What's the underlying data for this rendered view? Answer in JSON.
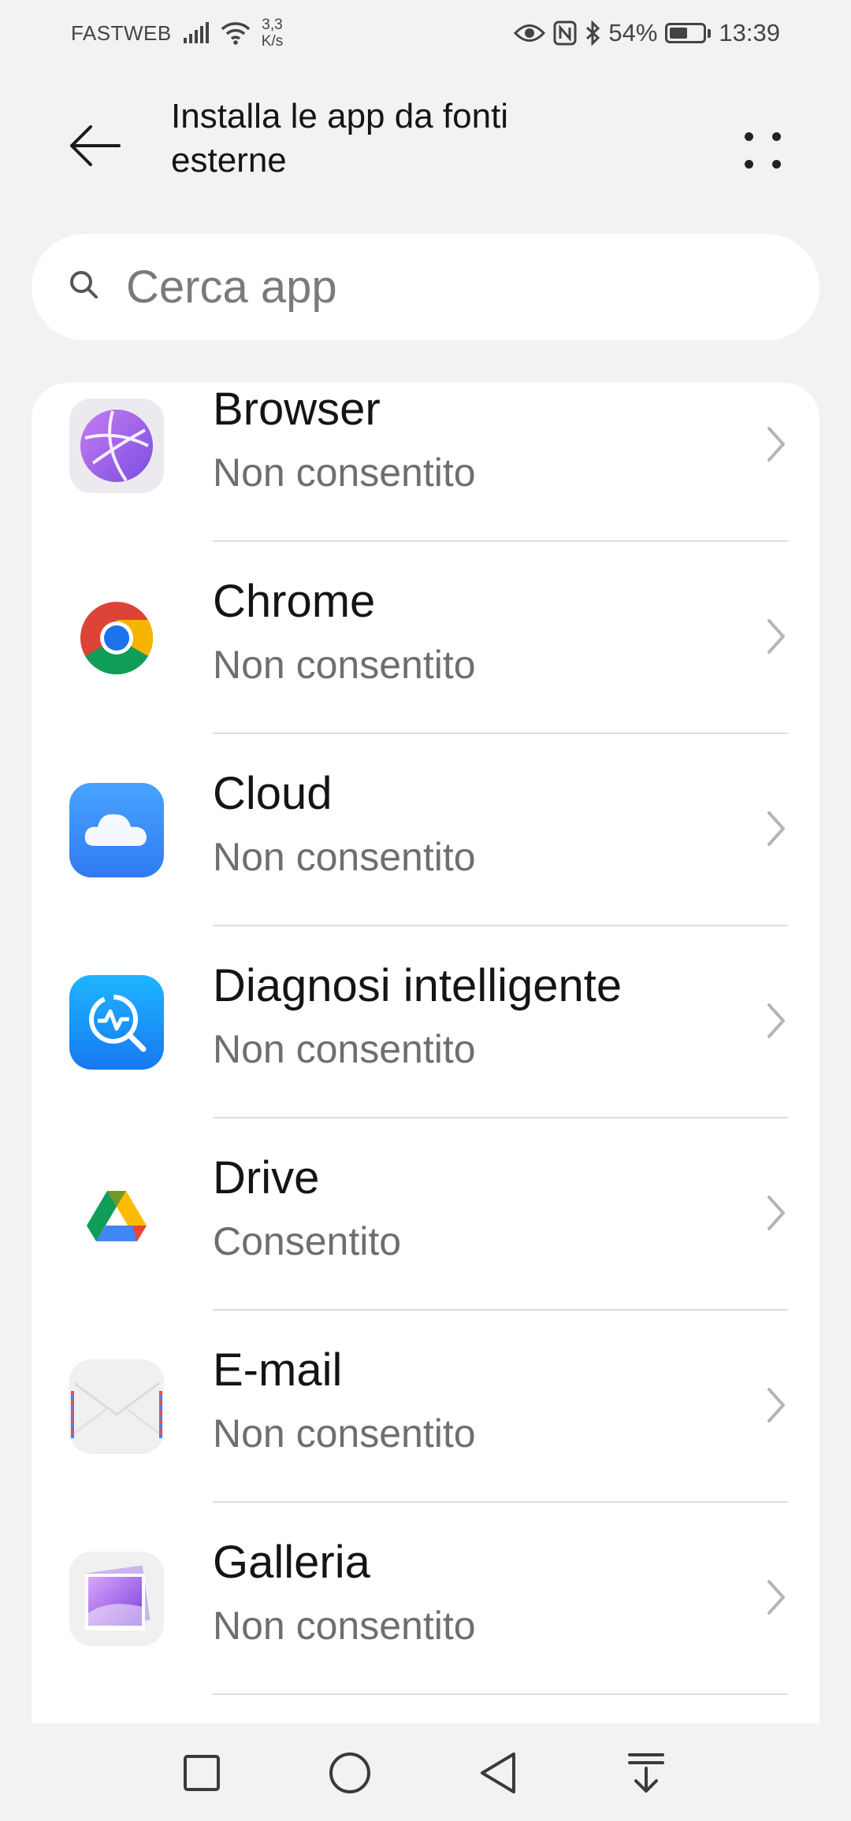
{
  "status_bar": {
    "carrier": "FASTWEB",
    "speed_value": "3,3",
    "speed_unit": "K/s",
    "battery": "54%",
    "battery_level": 0.54,
    "time": "13:39",
    "icons": [
      "signal-icon",
      "wifi-icon",
      "eye-icon",
      "nfc-icon",
      "bluetooth-icon",
      "battery-icon"
    ]
  },
  "header": {
    "title_line1": "Installa le app da fonti",
    "title_line2": "esterne",
    "back_icon": "back-arrow-icon",
    "more_icon": "more-options-icon"
  },
  "search": {
    "placeholder": "Cerca app",
    "value": ""
  },
  "apps": [
    {
      "name": "Browser",
      "status": "Non consentito",
      "icon": "browser-app-icon"
    },
    {
      "name": "Chrome",
      "status": "Non consentito",
      "icon": "chrome-app-icon"
    },
    {
      "name": "Cloud",
      "status": "Non consentito",
      "icon": "cloud-app-icon"
    },
    {
      "name": "Diagnosi intelligente",
      "status": "Non consentito",
      "icon": "diagnosis-app-icon"
    },
    {
      "name": "Drive",
      "status": "Consentito",
      "icon": "drive-app-icon"
    },
    {
      "name": "E-mail",
      "status": "Non consentito",
      "icon": "email-app-icon"
    },
    {
      "name": "Galleria",
      "status": "Non consentito",
      "icon": "gallery-app-icon"
    }
  ],
  "nav": {
    "icons": [
      "recents-square-icon",
      "home-circle-icon",
      "back-triangle-icon",
      "notification-pull-icon"
    ]
  },
  "colors": {
    "background": "#f1f2f4",
    "card": "#ffffff",
    "text_primary": "#141414",
    "text_secondary": "#6e6e6e"
  }
}
